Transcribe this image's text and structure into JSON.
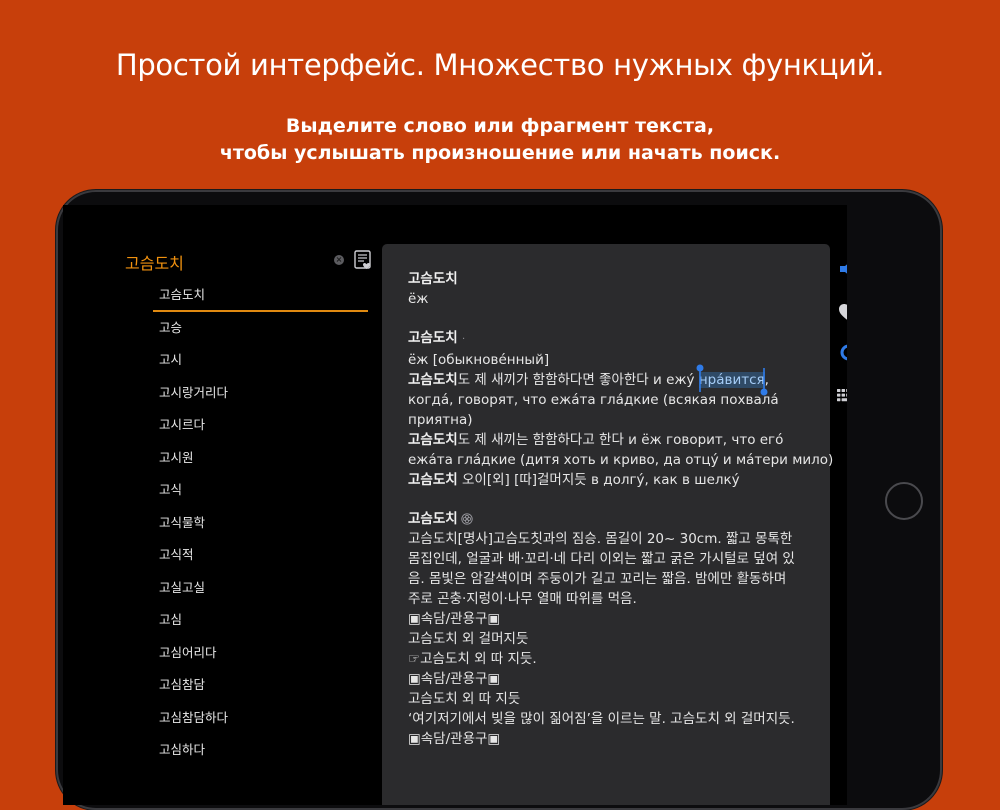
{
  "promo": {
    "headline": "Простой интерфейс. Множество нужных функций.",
    "sub_line1": "Выделите слово или фрагмент текста,",
    "sub_line2": "чтобы услышать произношение или начать поиск."
  },
  "colors": {
    "background": "#c73f0b",
    "accent": "#f0910f",
    "toolbar_icon_blue": "#2f7be8",
    "panel": "#2b2b2d"
  },
  "search": {
    "query": "고슴도치"
  },
  "icons": {
    "clear": "clear-search-icon",
    "bookmarks": "bookmarks-list-icon",
    "speaker": "speaker-icon",
    "heart": "heart-icon",
    "search": "search-icon",
    "keyboard": "keyboard-icon"
  },
  "word_list": [
    "고슴도치",
    "고승",
    "고시",
    "고시랑거리다",
    "고시르다",
    "고시원",
    "고식",
    "고식물학",
    "고식적",
    "고실고실",
    "고심",
    "고심어리다",
    "고심참담",
    "고심참담하다",
    "고심하다"
  ],
  "article": {
    "entry1_head": "고슴도치",
    "entry1_trans": "ёж",
    "entry2_head": "고슴도치",
    "entry2_trans": "ёж [обыкнове́нный]",
    "ex1_bold": "고슴도치",
    "ex1_rest_before": "도 제 새끼가 함함하다면 좋아한다 и ежу́ ",
    "ex1_selected": "нра́вится",
    "ex1_rest_after": ",",
    "ex1_line2": "когда́, говорят, что ежа́та гла́дкие (всякая похвала́",
    "ex1_line3": "приятна)",
    "ex2_bold": "고슴도치",
    "ex2_rest": "도 제 새끼는 함함하다고 한다 и ёж говорит, что его́",
    "ex2_line2": "ежа́та гла́дкие (дитя хоть и криво, да отцу́ и ма́тери мило)",
    "ex3_bold": "고슴도치",
    "ex3_rest": " 오이[외] [따]걸머지듯 в долгу́, как в шелку́",
    "entry3_head": "고슴도치",
    "def1": "고슴도치[명사]고슴도칫과의 짐승. 몸길이 20~ 30cm. 짧고 몽톡한",
    "def2": "몸집인데, 얼굴과 배·꼬리·네 다리 이외는 짧고 굵은 가시털로 덮여 있",
    "def3": "음. 몸빛은 암갈색이며 주둥이가 길고 꼬리는 짧음. 밤에만 활동하며",
    "def4": "주로 곤충·지렁이·나무 열매 따위를 먹음.",
    "idiom_label1": "▣속담/관용구▣",
    "idiom1": "고슴도치 외 걸머지듯",
    "idiom1_ref": "☞고슴도치 외 따 지듯.",
    "idiom_label2": "▣속담/관용구▣",
    "idiom2": "고슴도치 외 따 지듯",
    "idiom2_expl": "‘여기저기에서 빚을 많이 짊어짐’을 이르는 말. 고슴도치 외 걸머지듯.",
    "idiom_label3": "▣속담/관용구▣"
  }
}
